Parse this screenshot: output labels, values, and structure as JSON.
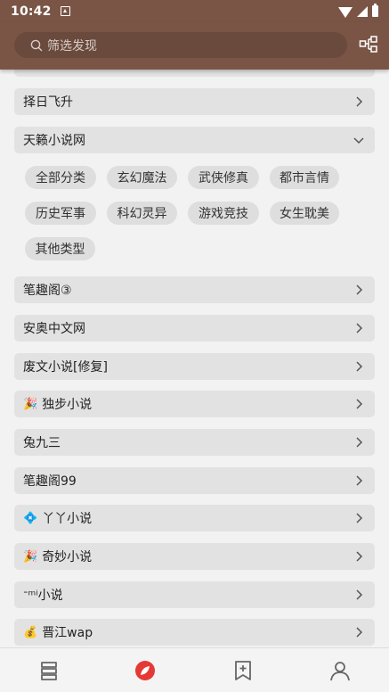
{
  "status_bar": {
    "time": "10:42"
  },
  "toolbar": {
    "search_placeholder": "筛选发现",
    "accent_color": "#7a5546"
  },
  "list": {
    "rows_before": [
      {
        "label": "择日飞升"
      }
    ],
    "expanded_source": {
      "label": "天籁小说网",
      "tags": [
        "全部分类",
        "玄幻魔法",
        "武侠修真",
        "都市言情",
        "历史军事",
        "科幻灵异",
        "游戏竞技",
        "女生耽美",
        "其他类型"
      ]
    },
    "rows_after": [
      {
        "emoji": "",
        "label": "笔趣阁③"
      },
      {
        "emoji": "",
        "label": "安奥中文网"
      },
      {
        "emoji": "",
        "label": "废文小说[修复]"
      },
      {
        "emoji": "🎉",
        "label": "独步小说"
      },
      {
        "emoji": "",
        "label": "兔九三"
      },
      {
        "emoji": "",
        "label": "笔趣阁99"
      },
      {
        "emoji": "💠",
        "label": "丫丫小说"
      },
      {
        "emoji": "🎉",
        "label": "奇妙小说"
      },
      {
        "emoji": "",
        "label": "ᐨᵐⁱ小说"
      },
      {
        "emoji": "💰",
        "label": "晋江wap"
      }
    ]
  },
  "bottom_nav": {
    "items": [
      "bookshelf-icon",
      "discover-icon",
      "bookmark-icon",
      "profile-icon"
    ],
    "active_color": "#e53935"
  }
}
